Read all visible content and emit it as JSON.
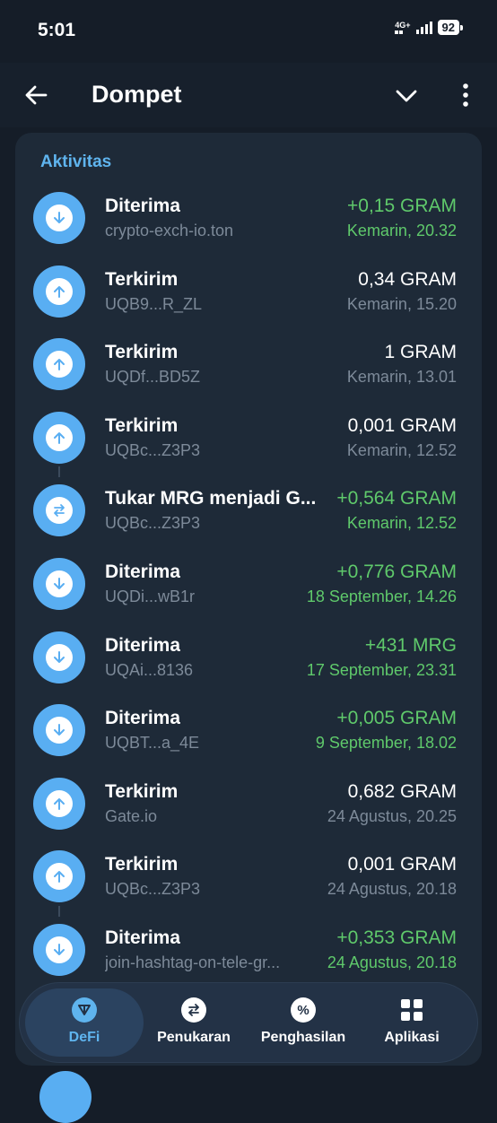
{
  "status_bar": {
    "time": "5:01",
    "network": "4G+",
    "battery": "92"
  },
  "header": {
    "title": "Dompet"
  },
  "section": {
    "title": "Aktivitas"
  },
  "transactions": [
    {
      "type": "received",
      "title": "Diterima",
      "address": "crypto-exch-io.ton",
      "amount": "+0,15 GRAM",
      "date": "Kemarin, 20.32",
      "positive": true
    },
    {
      "type": "sent",
      "title": "Terkirim",
      "address": "UQB9...R_ZL",
      "amount": "0,34 GRAM",
      "date": "Kemarin, 15.20",
      "positive": false
    },
    {
      "type": "sent",
      "title": "Terkirim",
      "address": "UQDf...BD5Z",
      "amount": "1 GRAM",
      "date": "Kemarin, 13.01",
      "positive": false
    },
    {
      "type": "sent",
      "title": "Terkirim",
      "address": "UQBc...Z3P3",
      "amount": "0,001 GRAM",
      "date": "Kemarin, 12.52",
      "positive": false
    },
    {
      "type": "swap",
      "title": "Tukar MRG menjadi G...",
      "address": "UQBc...Z3P3",
      "amount": "+0,564 GRAM",
      "date": "Kemarin, 12.52",
      "positive": true,
      "linked": true
    },
    {
      "type": "received",
      "title": "Diterima",
      "address": "UQDi...wB1r",
      "amount": "+0,776 GRAM",
      "date": "18 September, 14.26",
      "positive": true
    },
    {
      "type": "received",
      "title": "Diterima",
      "address": "UQAi...8136",
      "amount": "+431 MRG",
      "date": "17 September, 23.31",
      "positive": true
    },
    {
      "type": "received",
      "title": "Diterima",
      "address": "UQBT...a_4E",
      "amount": "+0,005 GRAM",
      "date": "9 September, 18.02",
      "positive": true
    },
    {
      "type": "sent",
      "title": "Terkirim",
      "address": "Gate.io",
      "amount": "0,682 GRAM",
      "date": "24 Agustus, 20.25",
      "positive": false
    },
    {
      "type": "sent",
      "title": "Terkirim",
      "address": "UQBc...Z3P3",
      "amount": "0,001 GRAM",
      "date": "24 Agustus, 20.18",
      "positive": false
    },
    {
      "type": "received",
      "title": "Diterima",
      "address": "join-hashtag-on-tele-gr...",
      "amount": "+0,353 GRAM",
      "date": "24 Agustus, 20.18",
      "positive": true,
      "linked": true
    }
  ],
  "nav": [
    {
      "label": "DeFi",
      "icon": "defi-icon",
      "active": true
    },
    {
      "label": "Penukaran",
      "icon": "swap-icon",
      "active": false
    },
    {
      "label": "Penghasilan",
      "icon": "percent-icon",
      "active": false
    },
    {
      "label": "Aplikasi",
      "icon": "apps-grid-icon",
      "active": false
    }
  ],
  "colors": {
    "background": "#151d28",
    "card": "#1e2a38",
    "accent": "#5fb4ee",
    "positive": "#5fc96b",
    "icon_circle": "#59aef2"
  }
}
